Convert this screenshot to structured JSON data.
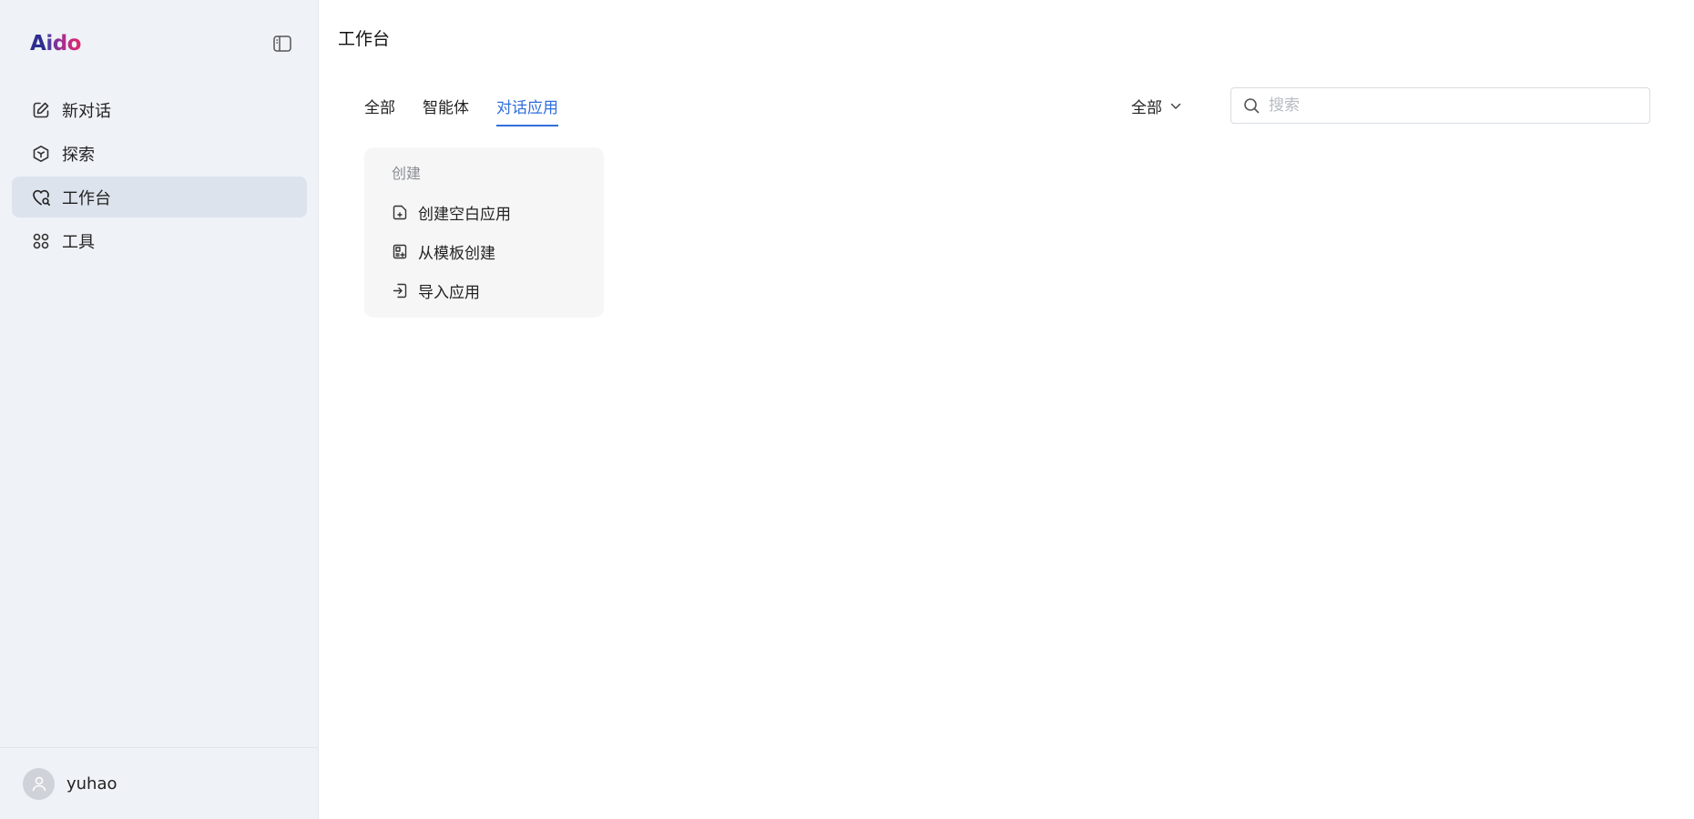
{
  "sidebar": {
    "logo": {
      "first": "A",
      "rest": "ido"
    },
    "collapse_icon": "sidebar-collapse-icon",
    "nav": [
      {
        "label": "新对话",
        "icon": "edit-icon",
        "active": false
      },
      {
        "label": "探索",
        "icon": "cube-icon",
        "active": false
      },
      {
        "label": "工作台",
        "icon": "heart-search-icon",
        "active": true
      },
      {
        "label": "工具",
        "icon": "grid-icon",
        "active": false
      }
    ],
    "user": {
      "name": "yuhao",
      "avatar_icon": "user-icon"
    }
  },
  "main": {
    "title": "工作台",
    "tabs": [
      {
        "label": "全部",
        "active": false
      },
      {
        "label": "智能体",
        "active": false
      },
      {
        "label": "对话应用",
        "active": true
      }
    ],
    "filter": {
      "selected": "全部",
      "icon": "chevron-down-icon"
    },
    "search": {
      "placeholder": "搜索",
      "value": "",
      "icon": "search-icon"
    },
    "create_card": {
      "title": "创建",
      "items": [
        {
          "label": "创建空白应用",
          "icon": "file-plus-icon"
        },
        {
          "label": "从模板创建",
          "icon": "template-icon"
        },
        {
          "label": "导入应用",
          "icon": "import-icon"
        }
      ]
    }
  },
  "colors": {
    "accent": "#2f6fdc",
    "sidebar_bg": "#eff2f7",
    "active_nav_bg": "#dde3ec",
    "card_bg": "#f6f6f7"
  }
}
